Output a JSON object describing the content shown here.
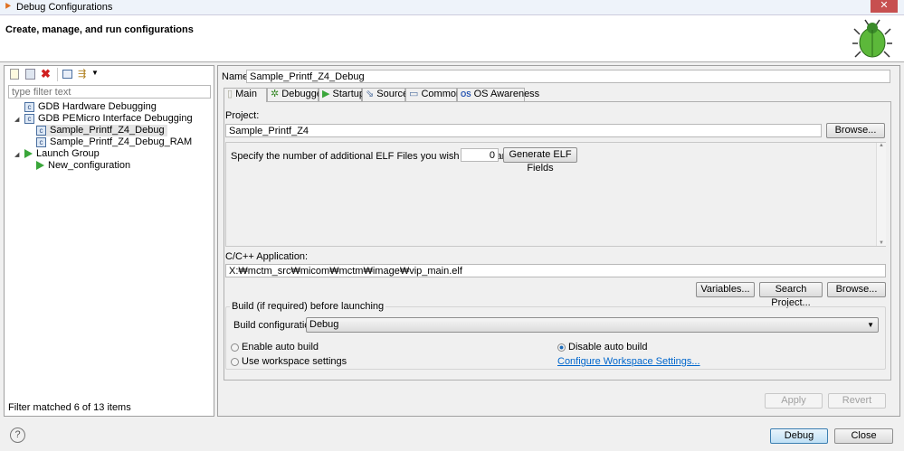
{
  "window": {
    "title": "Debug Configurations"
  },
  "header": {
    "title": "Create, manage, and run configurations"
  },
  "left": {
    "filter_placeholder": "type filter text",
    "tree": [
      {
        "label": "GDB Hardware Debugging",
        "icon": "c-config-icon",
        "level": 0
      },
      {
        "label": "GDB PEMicro Interface Debugging",
        "icon": "c-config-icon",
        "level": 0,
        "expanded": true
      },
      {
        "label": "Sample_Printf_Z4_Debug",
        "icon": "c-config-icon",
        "level": 1,
        "selected": true
      },
      {
        "label": "Sample_Printf_Z4_Debug_RAM",
        "icon": "c-config-icon",
        "level": 1
      },
      {
        "label": "Launch Group",
        "icon": "launch-icon",
        "level": 0,
        "expanded": true
      },
      {
        "label": "New_configuration",
        "icon": "launch-icon",
        "level": 1
      }
    ],
    "status": "Filter matched 6 of 13 items"
  },
  "right": {
    "name_label": "Name:",
    "name_value": "Sample_Printf_Z4_Debug",
    "tabs": [
      "Main",
      "Debugger",
      "Startup",
      "Source",
      "Common",
      "OS Awareness"
    ],
    "project_label": "Project:",
    "project_value": "Sample_Printf_Z4",
    "browse": "Browse...",
    "elf_label": "Specify the number of additional ELF Files you wish to program:",
    "elf_value": "0",
    "elf_button": "Generate ELF Fields",
    "app_label": "C/C++ Application:",
    "app_value": "X:₩mctm_src₩micom₩mctm₩image₩vip_main.elf",
    "variables": "Variables...",
    "search_project": "Search Project...",
    "build_group": "Build (if required) before launching",
    "build_config_label": "Build configuration:",
    "build_config_value": "Debug",
    "enable_auto": "Enable auto build",
    "disable_auto": "Disable auto build",
    "use_workspace": "Use workspace settings",
    "configure_link": "Configure Workspace Settings...",
    "apply": "Apply",
    "revert": "Revert"
  },
  "footer": {
    "help": "?",
    "debug": "Debug",
    "close": "Close"
  }
}
